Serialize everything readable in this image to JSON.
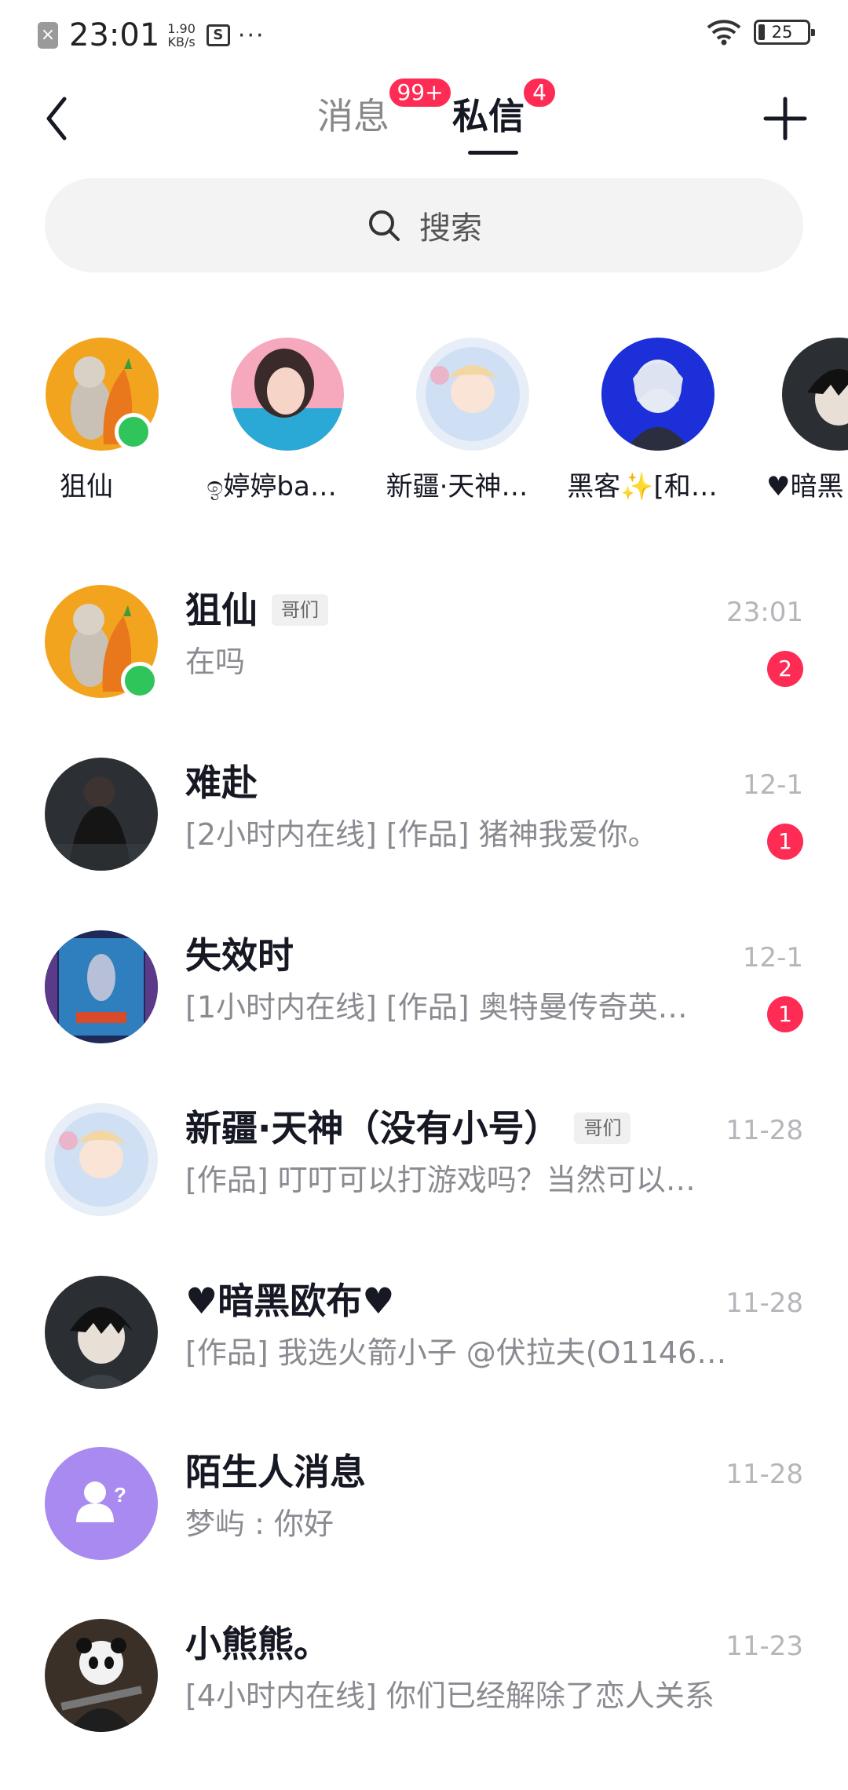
{
  "status_bar": {
    "notification_glyph": "×",
    "time": "23:01",
    "speed_value": "1.90",
    "speed_unit": "KB/s",
    "s_glyph": "S",
    "more_dots": "···",
    "battery": "25"
  },
  "header": {
    "tab_messages": "消息",
    "tab_messages_badge": "99+",
    "tab_dm": "私信",
    "tab_dm_badge": "4",
    "active_tab": "私信"
  },
  "search": {
    "placeholder": "搜索"
  },
  "stories": [
    {
      "name": "狙仙",
      "online": true
    },
    {
      "name": "ඉ婷婷ba…"
    },
    {
      "name": "新疆·天神…"
    },
    {
      "name": "黑客✨[和…"
    },
    {
      "name": "♥暗黑"
    }
  ],
  "conversations": [
    {
      "name": "狙仙",
      "tag": "哥们",
      "preview": "在吗",
      "time": "23:01",
      "unread": "2",
      "online": true
    },
    {
      "name": "难赴",
      "preview": "[2小时内在线] [作品] 猪神我爱你。",
      "time": "12-1",
      "unread": "1"
    },
    {
      "name": "失效时",
      "preview": "[1小时内在线] [作品] 奥特曼传奇英…",
      "time": "12-1",
      "unread": "1"
    },
    {
      "name": "新疆·天神（没有小号）",
      "tag": "哥们",
      "preview": "[作品] 叮叮可以打游戏吗？当然可以…",
      "time": "11-28"
    },
    {
      "name": "♥暗黑欧布♥",
      "preview": "[作品] 我选火箭小子 @伏拉夫(O1146…",
      "time": "11-28"
    },
    {
      "name": "陌生人消息",
      "preview": "梦屿 : 你好",
      "time": "11-28"
    },
    {
      "name": "小熊熊。",
      "preview": "[4小时内在线] 你们已经解除了恋人关系",
      "time": "11-23"
    }
  ],
  "colors": {
    "accent": "#fe2c55",
    "online": "#2fc55a",
    "stranger_avatar": "#a98af0"
  },
  "icons": [
    "back-icon",
    "plus-icon",
    "search-icon",
    "wifi-icon",
    "battery-icon",
    "stranger-icon"
  ]
}
